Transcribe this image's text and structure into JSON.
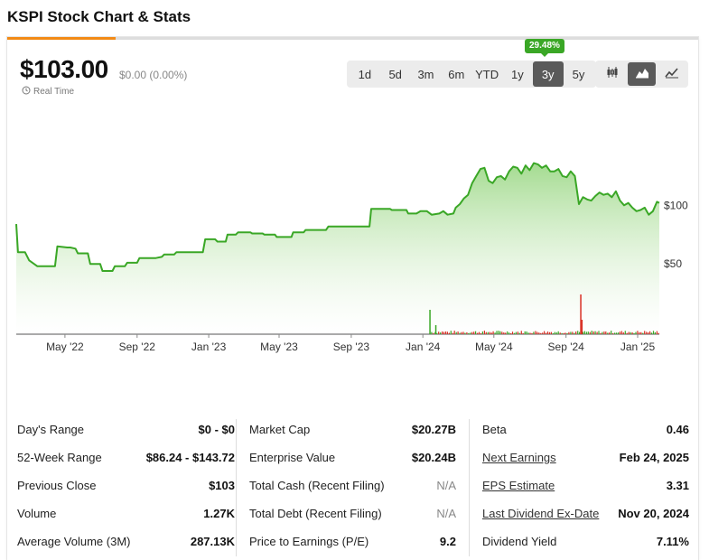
{
  "page": {
    "title": "KSPI Stock Chart & Stats"
  },
  "quote": {
    "price": "$103.00",
    "change": "$0.00 (0.00%)",
    "realtime_label": "Real Time",
    "realtime_icon": "clock-icon"
  },
  "range": {
    "badge": "29.48%",
    "options": [
      "1d",
      "5d",
      "3m",
      "6m",
      "YTD",
      "1y",
      "3y",
      "5y"
    ],
    "active": "3y"
  },
  "chart_types": [
    {
      "icon": "candlestick-icon",
      "active": false
    },
    {
      "icon": "area-chart-icon",
      "active": true
    },
    {
      "icon": "line-chart-icon",
      "active": false
    }
  ],
  "colors": {
    "line": "#3aa726",
    "fill_top": "#9fd98a",
    "volume_up": "#3aa726",
    "volume_down": "#d93025",
    "accent": "#f28a16"
  },
  "chart_data": {
    "type": "area",
    "title": "",
    "xlabel": "",
    "ylabel": "",
    "x_tick_labels": [
      "May '22",
      "Sep '22",
      "Jan '23",
      "May '23",
      "Sep '23",
      "Jan '24",
      "May '24",
      "Sep '24",
      "Jan '25"
    ],
    "y_tick_labels": [
      "$100",
      "$50"
    ],
    "y_ticks": [
      100,
      50
    ],
    "ylim": [
      -10,
      155
    ],
    "x_range": [
      "2022-02-07",
      "2025-02-07"
    ],
    "grid": false,
    "legend": "none",
    "series": [
      {
        "x": [
          "2022-02-07",
          "2022-02-10",
          "2022-02-22",
          "2022-03-01",
          "2022-03-15",
          "2022-03-24",
          "2022-03-28",
          "2022-04-14",
          "2022-04-18",
          "2022-05-05",
          "2022-05-10",
          "2022-05-19",
          "2022-05-23",
          "2022-06-09",
          "2022-06-13",
          "2022-06-30",
          "2022-07-04",
          "2022-07-21",
          "2022-07-25",
          "2022-08-11",
          "2022-08-15",
          "2022-09-01",
          "2022-09-05",
          "2022-09-29",
          "2022-10-03",
          "2022-10-13",
          "2022-10-17",
          "2022-11-03",
          "2022-11-07",
          "2022-11-21",
          "2022-11-24",
          "2022-12-22",
          "2022-12-26",
          "2023-01-12",
          "2023-01-16",
          "2023-01-30",
          "2023-02-02",
          "2023-02-16",
          "2023-02-20",
          "2023-03-13",
          "2023-03-16",
          "2023-04-03",
          "2023-04-06",
          "2023-04-24",
          "2023-04-27",
          "2023-05-22",
          "2023-05-25",
          "2023-06-12",
          "2023-06-15",
          "2023-07-20",
          "2023-07-24",
          "2023-08-10",
          "2023-08-14",
          "2023-09-04",
          "2023-09-07",
          "2023-10-02",
          "2023-10-05",
          "2023-11-06",
          "2023-11-09",
          "2023-12-04",
          "2023-12-07",
          "2023-12-21",
          "2023-12-28",
          "2024-01-08",
          "2024-01-16",
          "2024-01-29",
          "2024-02-05",
          "2024-02-12",
          "2024-02-22",
          "2024-02-26",
          "2024-03-04",
          "2024-03-11",
          "2024-03-18",
          "2024-03-25",
          "2024-04-01",
          "2024-04-08",
          "2024-04-15",
          "2024-04-22",
          "2024-04-29",
          "2024-05-06",
          "2024-05-13",
          "2024-05-20",
          "2024-05-27",
          "2024-06-03",
          "2024-06-10",
          "2024-06-17",
          "2024-06-24",
          "2024-07-01",
          "2024-07-08",
          "2024-07-15",
          "2024-07-22",
          "2024-07-29",
          "2024-08-05",
          "2024-08-12",
          "2024-08-19",
          "2024-08-26",
          "2024-09-02",
          "2024-09-09",
          "2024-09-16",
          "2024-09-23",
          "2024-09-30",
          "2024-10-07",
          "2024-10-14",
          "2024-10-21",
          "2024-10-28",
          "2024-11-04",
          "2024-11-11",
          "2024-11-18",
          "2024-11-25",
          "2024-12-02",
          "2024-12-09",
          "2024-12-16",
          "2024-12-23",
          "2024-12-30",
          "2025-01-06",
          "2025-01-13",
          "2025-01-20",
          "2025-01-27",
          "2025-02-03",
          "2025-02-07"
        ],
        "y": [
          84,
          60,
          60,
          53,
          48,
          48,
          48,
          48,
          65,
          64,
          64,
          63,
          59,
          59,
          50,
          50,
          44,
          44,
          48,
          48,
          51,
          51,
          55,
          55,
          55,
          56,
          58,
          58,
          60,
          60,
          60,
          60,
          71,
          71,
          69,
          69,
          75,
          75,
          77,
          77,
          76,
          76,
          75,
          75,
          73,
          73,
          77,
          77,
          79,
          79,
          82,
          82,
          82,
          82,
          82,
          82,
          97,
          97,
          96,
          96,
          93,
          93,
          95,
          95,
          92,
          93,
          95,
          92,
          93,
          98,
          101,
          106,
          109,
          119,
          125,
          131,
          132,
          121,
          119,
          124,
          125,
          122,
          129,
          133,
          132,
          127,
          134,
          130,
          136,
          135,
          132,
          134,
          129,
          129,
          131,
          125,
          124,
          129,
          125,
          101,
          107,
          105,
          104,
          108,
          111,
          109,
          110,
          107,
          112,
          104,
          100,
          102,
          98,
          95,
          96,
          98,
          92,
          95,
          103,
          102
        ]
      }
    ],
    "volume_spikes": [
      {
        "x": "2024-01-12",
        "value": 27
      },
      {
        "x": "2024-01-22",
        "value": 10
      },
      {
        "x": "2024-09-25",
        "value": 44
      },
      {
        "x": "2024-09-27",
        "value": 16
      }
    ]
  },
  "stats": {
    "col1": [
      {
        "label": "Day's Range",
        "value": "$0 - $0"
      },
      {
        "label": "52-Week Range",
        "value": "$86.24 - $143.72"
      },
      {
        "label": "Previous Close",
        "value": "$103"
      },
      {
        "label": "Volume",
        "value": "1.27K"
      },
      {
        "label": "Average Volume (3M)",
        "value": "287.13K"
      }
    ],
    "col2": [
      {
        "label": "Market Cap",
        "value": "$20.27B"
      },
      {
        "label": "Enterprise Value",
        "value": "$20.24B"
      },
      {
        "label": "Total Cash (Recent Filing)",
        "value": "N/A"
      },
      {
        "label": "Total Debt (Recent Filing)",
        "value": "N/A"
      },
      {
        "label": "Price to Earnings (P/E)",
        "value": "9.2"
      }
    ],
    "col3": [
      {
        "label": "Beta",
        "value": "0.46"
      },
      {
        "label": "Next Earnings",
        "value": "Feb 24, 2025"
      },
      {
        "label": "EPS Estimate",
        "value": "3.31"
      },
      {
        "label": "Last Dividend Ex-Date",
        "value": "Nov 20, 2024"
      },
      {
        "label": "Dividend Yield",
        "value": "7.11%"
      }
    ]
  }
}
